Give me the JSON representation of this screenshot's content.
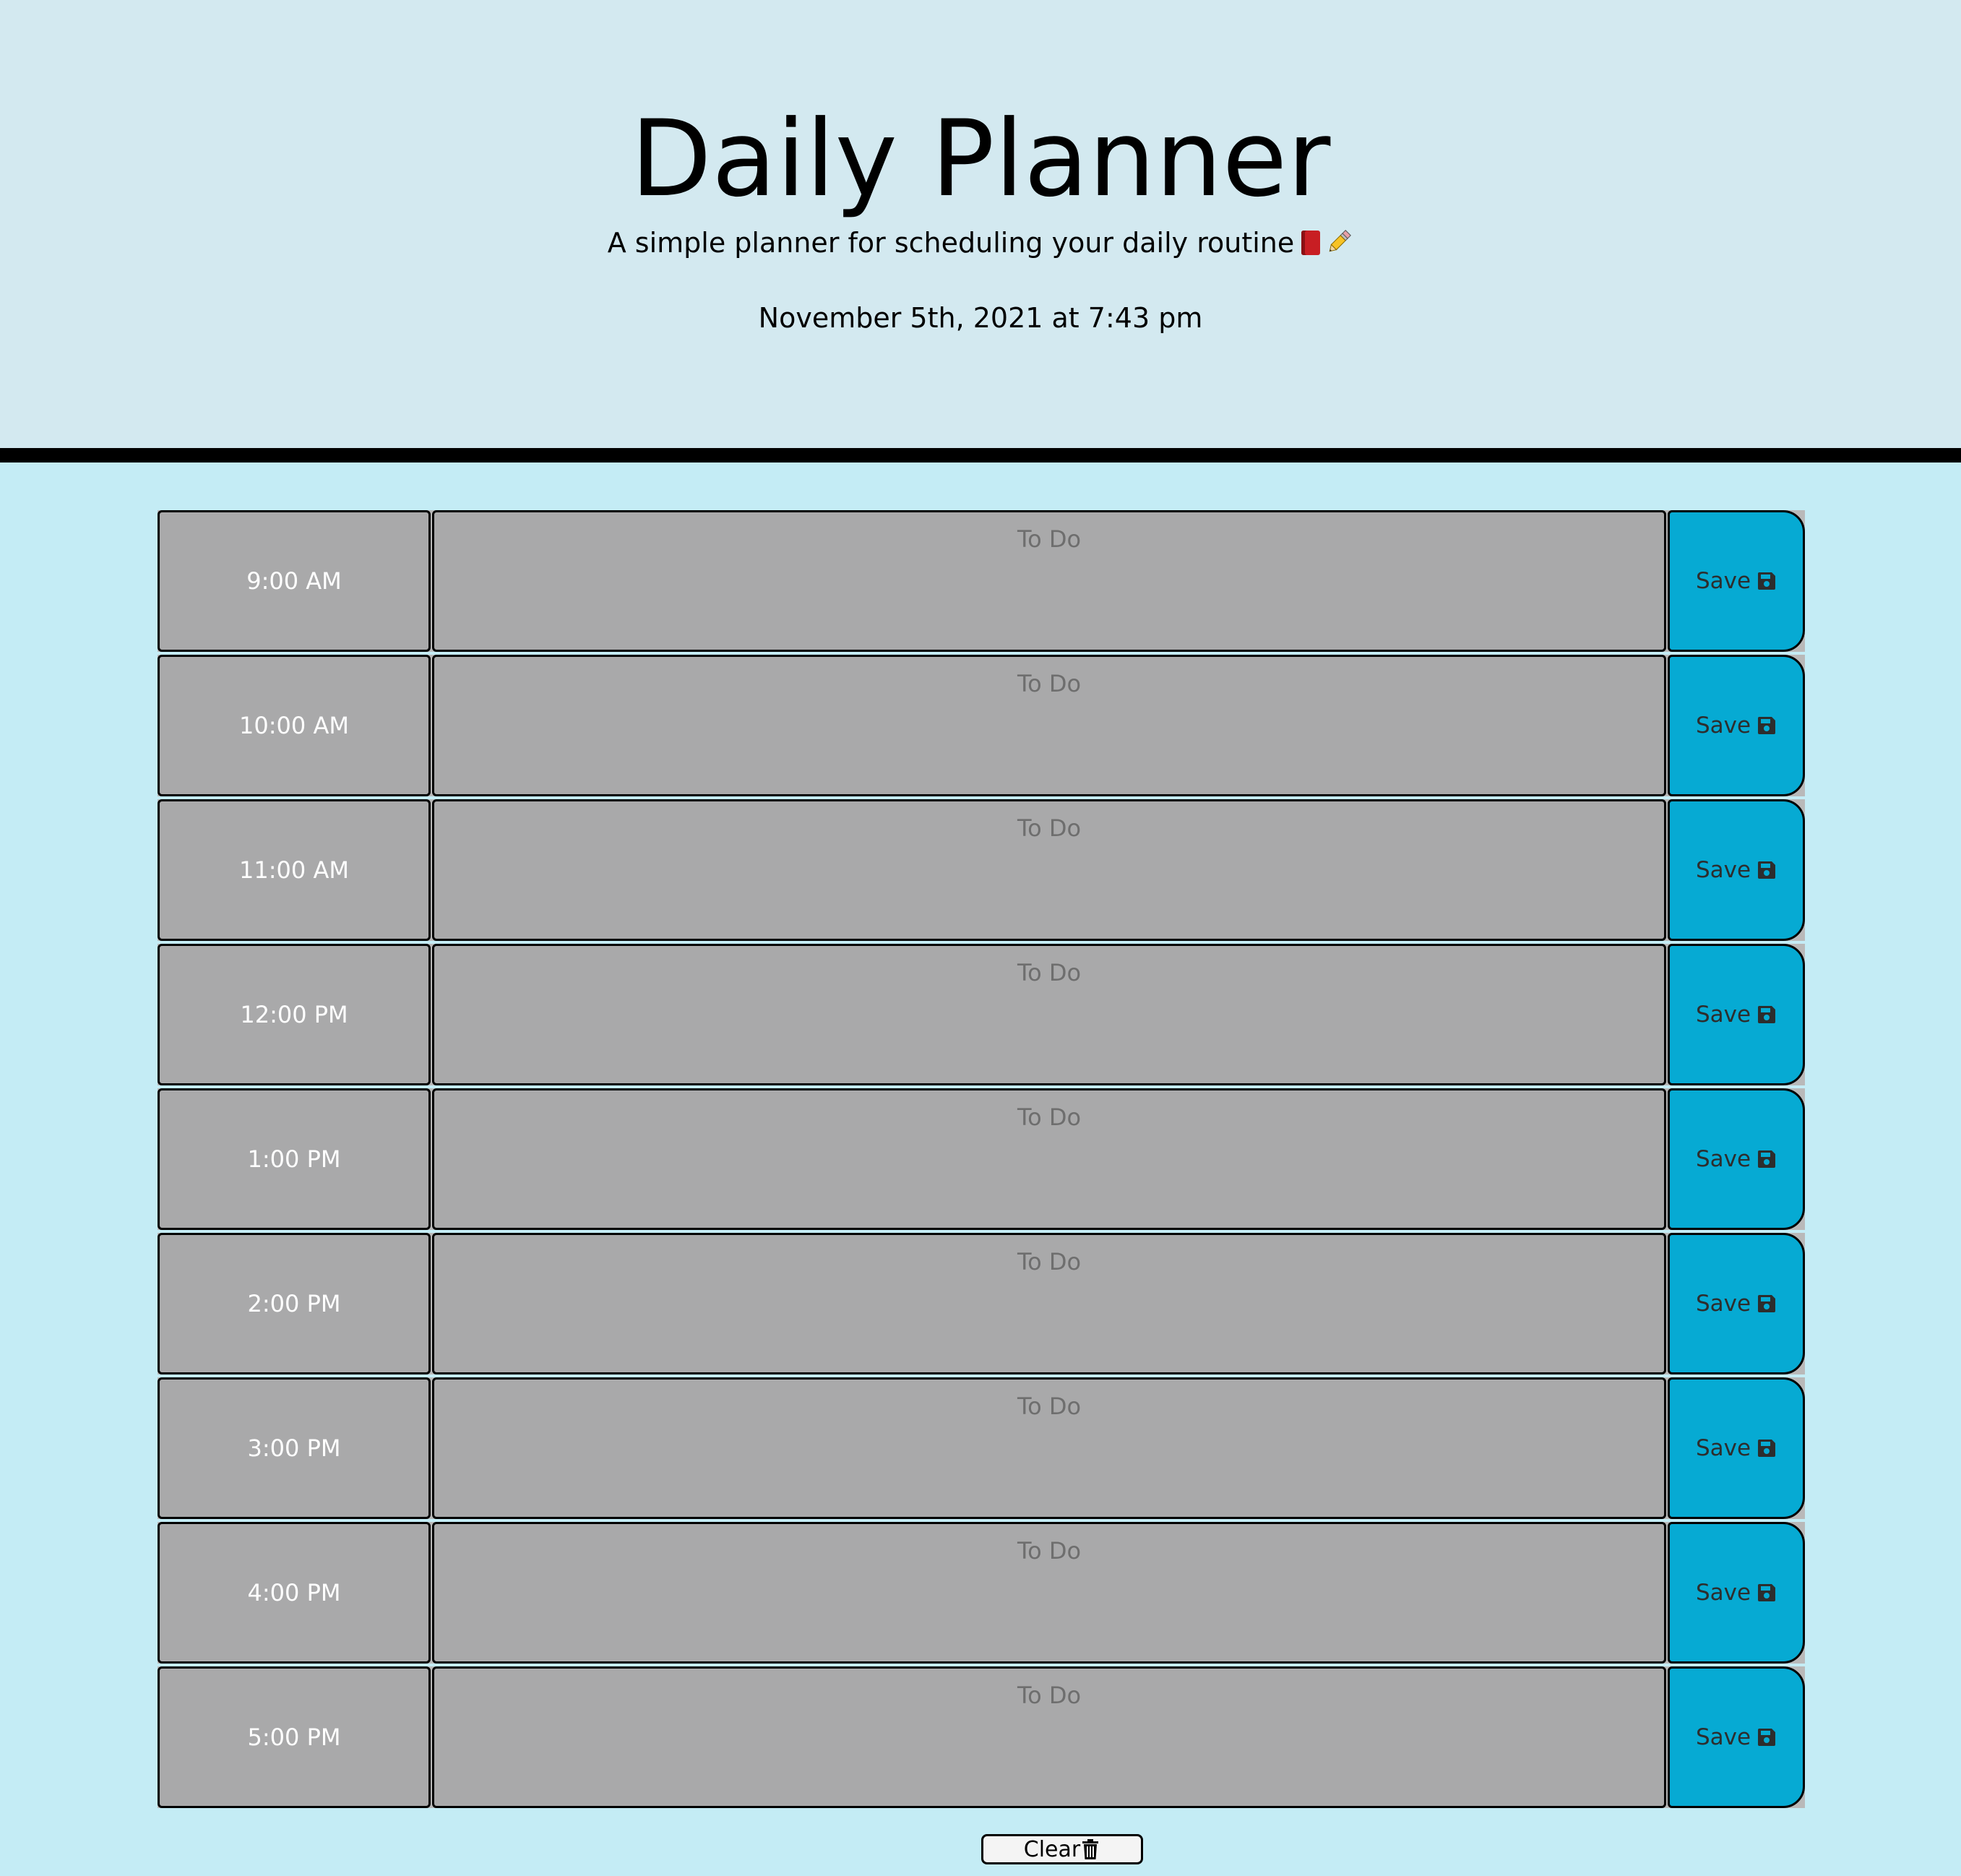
{
  "header": {
    "title": "Daily Planner",
    "subtitle": "A simple planner for scheduling your daily routine",
    "subtitle_icons": [
      "red-book-icon",
      "pencil-icon"
    ],
    "date": "November 5th, 2021 at 7:43 pm"
  },
  "planner": {
    "rows": [
      {
        "hour": "9:00 AM",
        "placeholder": "To Do",
        "value": "",
        "save_label": "Save"
      },
      {
        "hour": "10:00 AM",
        "placeholder": "To Do",
        "value": "",
        "save_label": "Save"
      },
      {
        "hour": "11:00 AM",
        "placeholder": "To Do",
        "value": "",
        "save_label": "Save"
      },
      {
        "hour": "12:00 PM",
        "placeholder": "To Do",
        "value": "",
        "save_label": "Save"
      },
      {
        "hour": "1:00 PM",
        "placeholder": "To Do",
        "value": "",
        "save_label": "Save"
      },
      {
        "hour": "2:00 PM",
        "placeholder": "To Do",
        "value": "",
        "save_label": "Save"
      },
      {
        "hour": "3:00 PM",
        "placeholder": "To Do",
        "value": "",
        "save_label": "Save"
      },
      {
        "hour": "4:00 PM",
        "placeholder": "To Do",
        "value": "",
        "save_label": "Save"
      },
      {
        "hour": "5:00 PM",
        "placeholder": "To Do",
        "value": "",
        "save_label": "Save"
      }
    ],
    "row_state": "past",
    "save_icon": "floppy-disk-icon"
  },
  "footer": {
    "clear_label": "Clear",
    "clear_icon": "trash-icon"
  },
  "colors": {
    "header_background": "#d3e9f0",
    "page_background": "#c4ecf5",
    "past_row": "#a9a9aa",
    "save_button": "#06aad3"
  }
}
